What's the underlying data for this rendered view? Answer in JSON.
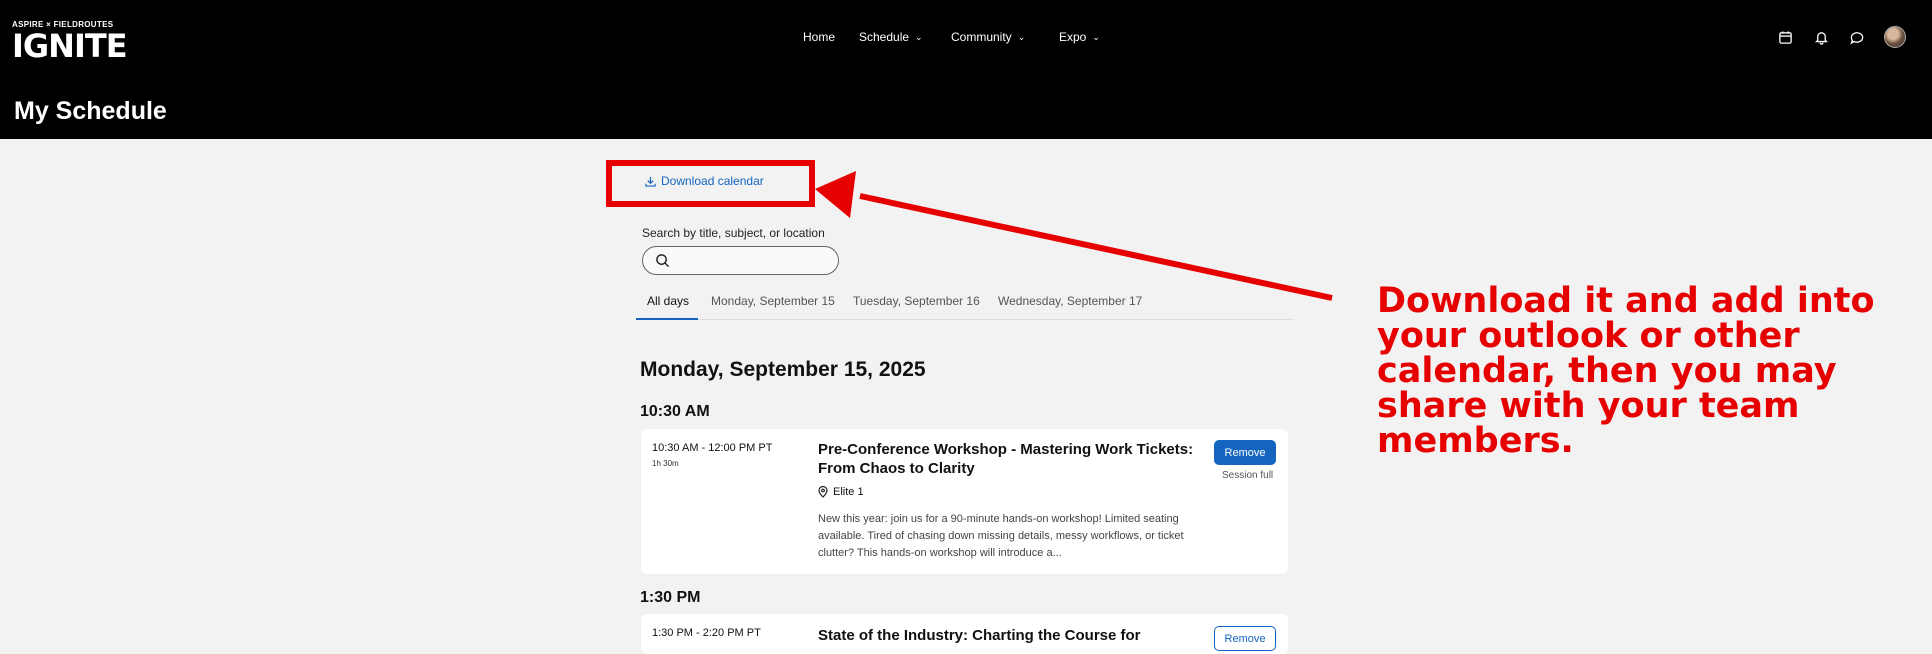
{
  "header": {
    "brand_top": "ASPIRE × FIELDROUTES",
    "brand_main": "IGNITE",
    "nav": [
      {
        "label": "Home",
        "has_dropdown": false
      },
      {
        "label": "Schedule",
        "has_dropdown": true
      },
      {
        "label": "Community",
        "has_dropdown": true
      },
      {
        "label": "Expo",
        "has_dropdown": true
      }
    ],
    "icons": [
      "calendar-icon",
      "bell-icon",
      "chat-icon",
      "avatar"
    ],
    "page_title": "My Schedule"
  },
  "toolbar": {
    "download_label": "Download calendar",
    "search_label": "Search by title, subject, or location",
    "search_value": ""
  },
  "tabs": [
    {
      "label": "All days",
      "active": true
    },
    {
      "label": "Monday, September 15",
      "active": false
    },
    {
      "label": "Tuesday, September 16",
      "active": false
    },
    {
      "label": "Wednesday, September 17",
      "active": false
    }
  ],
  "schedule": {
    "day_heading": "Monday, September 15, 2025",
    "slots": [
      {
        "time_heading": "10:30 AM",
        "session": {
          "time": "10:30 AM - 12:00 PM PT",
          "duration": "1h 30m",
          "title": "Pre-Conference Workshop - Mastering Work Tickets: From Chaos to Clarity",
          "location": "Elite 1",
          "description": "New this year: join us for a 90-minute hands-on workshop! Limited seating available. Tired of chasing down missing details, messy workflows, or ticket clutter? This hands-on workshop will introduce a...",
          "button": "Remove",
          "status": "Session full"
        }
      },
      {
        "time_heading": "1:30 PM",
        "session": {
          "time": "1:30 PM - 2:20 PM PT",
          "title": "State of the Industry: Charting the Course for",
          "button": "Remove"
        }
      }
    ]
  },
  "annotation": {
    "text": "Download it and add into your outlook or other calendar, then you may share with your team members.",
    "color": "#e60000"
  },
  "colors": {
    "accent": "#1565c0",
    "header_bg": "#000000",
    "page_bg": "#f2f2f2"
  }
}
